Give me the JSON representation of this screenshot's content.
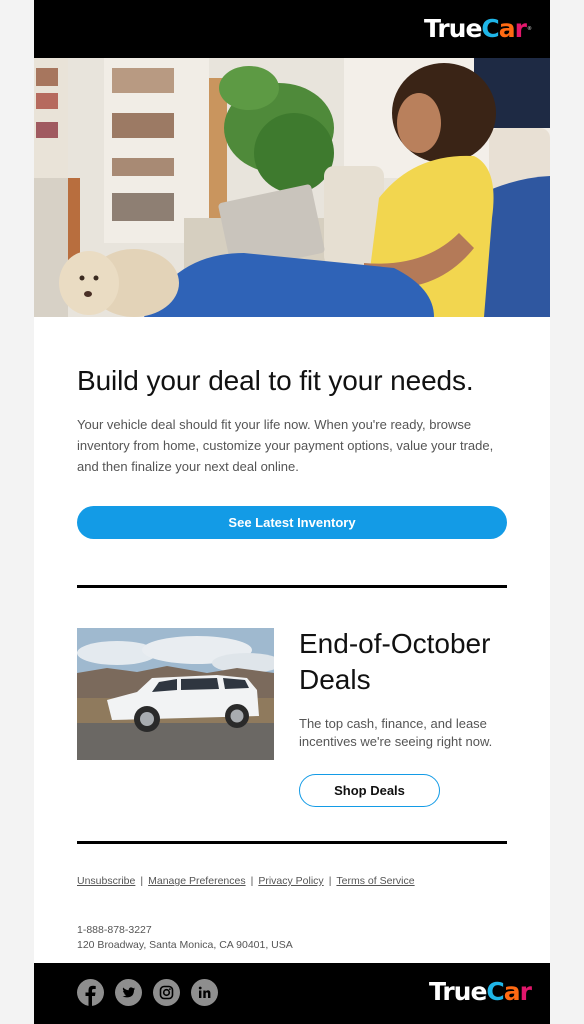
{
  "header": {
    "logo": {
      "part1": "True",
      "part2a": "C",
      "part2b": "a",
      "part2c": "r",
      "reg": "®"
    }
  },
  "hero": {
    "image_alt": "Woman on sofa using tablet with dog nearby"
  },
  "main": {
    "title": "Build your deal to fit your needs.",
    "body": "Your vehicle deal should fit your life now. When you're ready, browse inventory from home, customize your payment options, value your trade, and then finalize your next deal online.",
    "cta_label": "See Latest Inventory"
  },
  "promo": {
    "image_alt": "White SUV parked on desert road",
    "title": "End-of-October Deals",
    "body": "The top cash, finance, and lease incentives we're seeing right now.",
    "cta_label": "Shop Deals"
  },
  "footer_links": [
    {
      "label": "Unsubscribe"
    },
    {
      "label": "Manage Preferences"
    },
    {
      "label": "Privacy Policy"
    },
    {
      "label": "Terms of Service"
    }
  ],
  "separator": "|",
  "contact": {
    "phone": "1-888-878-3227",
    "address": "120 Broadway, Santa Monica, CA 90401, USA"
  },
  "social": [
    {
      "icon": "facebook-icon"
    },
    {
      "icon": "twitter-icon"
    },
    {
      "icon": "instagram-icon"
    },
    {
      "icon": "linkedin-icon"
    }
  ],
  "colors": {
    "accent": "#139be6",
    "logo_cyan": "#1fb6e8",
    "logo_orange": "#ff6a13",
    "logo_magenta": "#e3176c"
  }
}
